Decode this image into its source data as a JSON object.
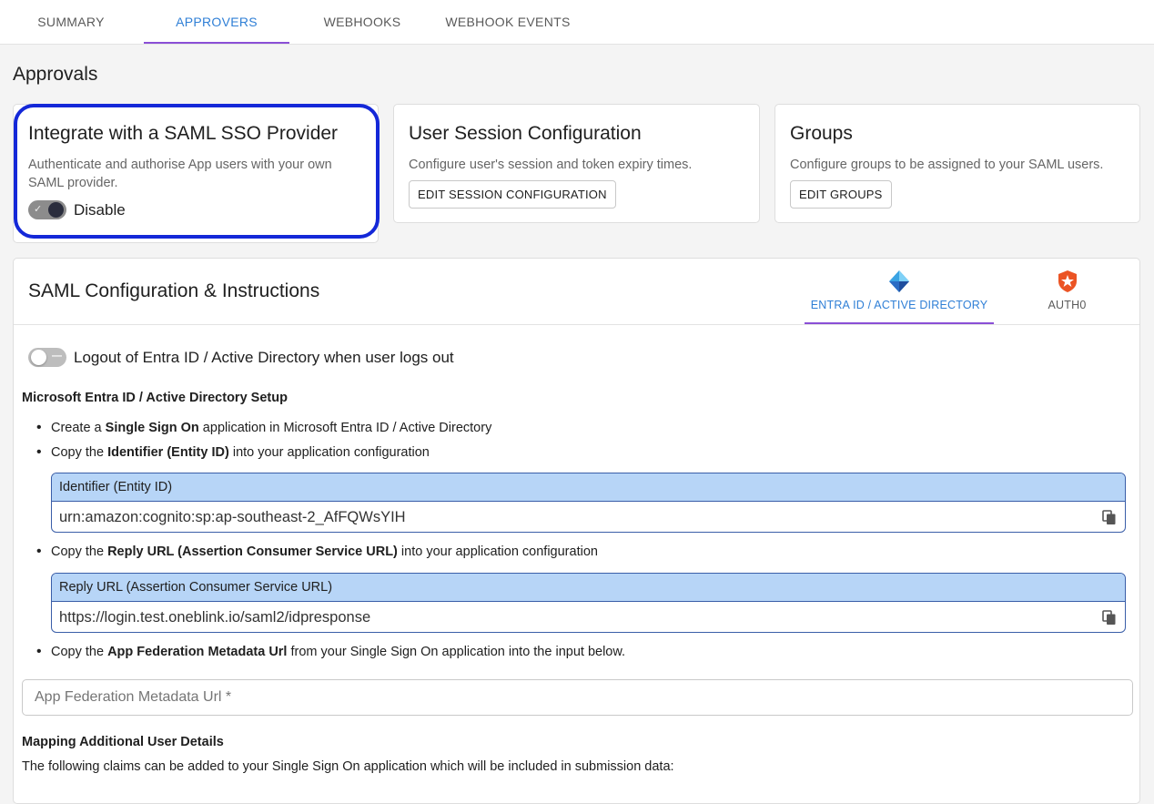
{
  "tabs": [
    {
      "label": "SUMMARY"
    },
    {
      "label": "APPROVERS"
    },
    {
      "label": "WEBHOOKS"
    },
    {
      "label": "WEBHOOK EVENTS"
    }
  ],
  "section": {
    "title": "Approvals"
  },
  "cards": {
    "saml": {
      "title": "Integrate with a SAML SSO Provider",
      "description": "Authenticate and authorise App users with your own SAML provider.",
      "toggle_label": "Disable",
      "toggle_on": true
    },
    "session": {
      "title": "User Session Configuration",
      "description": "Configure user's session and token expiry times.",
      "button": "EDIT SESSION CONFIGURATION"
    },
    "groups": {
      "title": "Groups",
      "description": "Configure groups to be assigned to your SAML users.",
      "button": "EDIT GROUPS"
    }
  },
  "config": {
    "title": "SAML Configuration & Instructions",
    "provider_tabs": [
      {
        "label": "ENTRA ID / ACTIVE DIRECTORY",
        "icon": "entra-id-icon",
        "active": true
      },
      {
        "label": "AUTH0",
        "icon": "auth0-icon",
        "active": false
      }
    ],
    "logout_toggle_label": "Logout of Entra ID / Active Directory when user logs out",
    "logout_toggle_on": false,
    "setup_heading": "Microsoft Entra ID / Active Directory Setup",
    "steps": [
      {
        "pre": "Create a ",
        "bold": "Single Sign On",
        "post": " application in Microsoft Entra ID / Active Directory"
      },
      {
        "pre": "Copy the ",
        "bold": "Identifier (Entity ID)",
        "post": " into your application configuration"
      },
      {
        "pre": "Copy the ",
        "bold": "Reply URL (Assertion Consumer Service URL)",
        "post": " into your application configuration"
      },
      {
        "pre": "Copy the ",
        "bold": "App Federation Metadata Url",
        "post": " from your Single Sign On application into the input below."
      }
    ],
    "identifier": {
      "label": "Identifier (Entity ID)",
      "value": "urn:amazon:cognito:sp:ap-southeast-2_AfFQWsYIH"
    },
    "reply_url": {
      "label": "Reply URL (Assertion Consumer Service URL)",
      "value": "https://login.test.oneblink.io/saml2/idpresponse"
    },
    "metadata_input": {
      "placeholder": "App Federation Metadata Url *",
      "value": ""
    },
    "mapping_heading": "Mapping Additional User Details",
    "mapping_text": "The following claims can be added to your Single Sign On application which will be included in submission data:"
  },
  "colors": {
    "accent_blue": "#2f7fd6",
    "indicator_purple": "#8a4fd6",
    "highlight_border": "#1428d8",
    "copybox_header": "#b7d5f7"
  }
}
